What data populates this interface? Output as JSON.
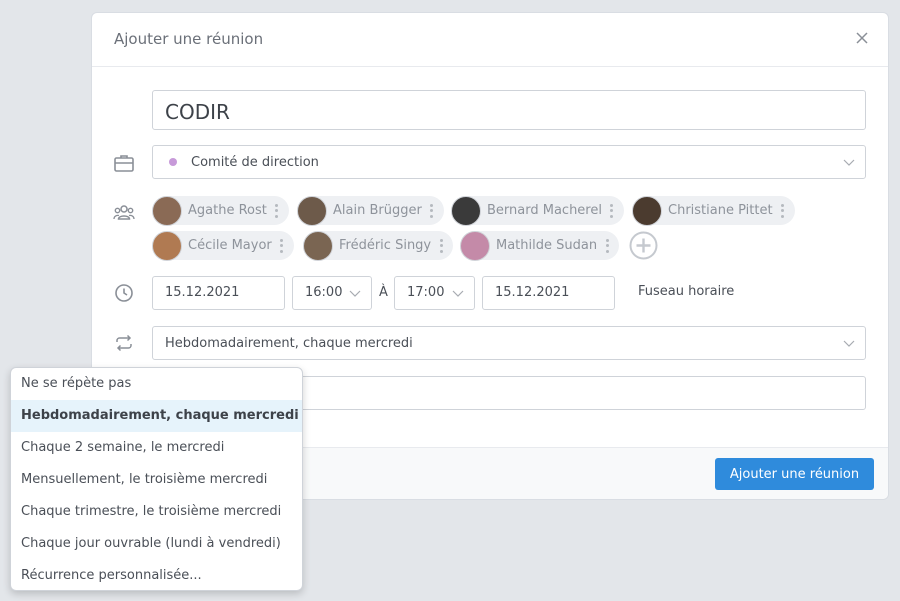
{
  "modal": {
    "title": "Ajouter une réunion",
    "meeting_title": "CODIR",
    "team": {
      "label": "Comité de direction",
      "color": "#c79ad9"
    },
    "participants": [
      {
        "name": "Agathe Rost",
        "avatar_color": "#8a6a55"
      },
      {
        "name": "Alain Brügger",
        "avatar_color": "#6d5a4a"
      },
      {
        "name": "Bernard Macherel",
        "avatar_color": "#3a3a3a"
      },
      {
        "name": "Christiane Pittet",
        "avatar_color": "#4b3b2f"
      },
      {
        "name": "Cécile Mayor",
        "avatar_color": "#b07a52"
      },
      {
        "name": "Frédéric Singy",
        "avatar_color": "#7a6552"
      },
      {
        "name": "Mathilde Sudan",
        "avatar_color": "#c48aa8"
      }
    ],
    "start_date": "15.12.2021",
    "start_time": "16:00",
    "time_separator": "À",
    "end_time": "17:00",
    "end_date": "15.12.2021",
    "timezone_label": "Fuseau horaire",
    "recurrence": "Hebdomadairement, chaque mercredi",
    "submit_label": "Ajouter une réunion"
  },
  "recurrence_dropdown": {
    "options": [
      "Ne se répète pas",
      "Hebdomadairement, chaque mercredi",
      "Chaque 2 semaine, le mercredi",
      "Mensuellement, le troisième mercredi",
      "Chaque trimestre, le troisième mercredi",
      "Chaque jour ouvrable (lundi à vendredi)",
      "Récurrence personnalisée..."
    ],
    "selected_index": 1
  },
  "colors": {
    "primary": "#2f8bdc",
    "selected_bg": "#e6f3fb"
  }
}
